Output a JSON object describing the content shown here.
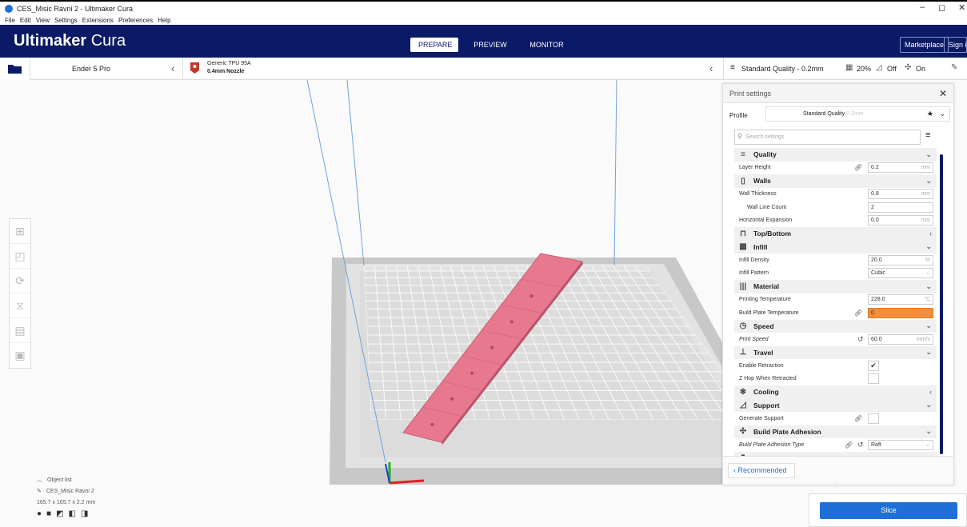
{
  "window": {
    "title": "CES_Misic Ravni 2 - Ultimaker Cura",
    "minimize": "–",
    "maximize": "◻",
    "close": "✕"
  },
  "menu": [
    "File",
    "Edit",
    "View",
    "Settings",
    "Extensions",
    "Preferences",
    "Help"
  ],
  "header": {
    "logo_bold": "Ultimaker",
    "logo_light": "Cura",
    "stages": [
      "PREPARE",
      "PREVIEW",
      "MONITOR"
    ],
    "marketplace": "Marketplace",
    "signin": "Sign in"
  },
  "machine": {
    "name": "Ender 5 Pro",
    "back": "‹"
  },
  "material": {
    "name": "Generic TPU 95A",
    "nozzle": "0.4mm Nozzle",
    "back": "‹"
  },
  "quality": {
    "profile": "Standard Quality - 0.2mm",
    "infill": "20%",
    "support": "Off",
    "adhesion": "On"
  },
  "panel": {
    "title": "Print settings",
    "profile_label": "Profile",
    "profile_value": "Standard Quality",
    "profile_suffix": "0.2mm",
    "search_placeholder": "Search settings",
    "recommended": "‹ Recommended",
    "rows": [
      {
        "kind": "cat",
        "icon": "≡",
        "label": "Quality",
        "chev": "⌄"
      },
      {
        "kind": "set",
        "label": "Layer Height",
        "value": "0.2",
        "unit": "mm",
        "link": true
      },
      {
        "kind": "cat",
        "icon": "▯",
        "label": "Walls",
        "chev": "⌄"
      },
      {
        "kind": "set",
        "label": "Wall Thickness",
        "value": "0.8",
        "unit": "mm"
      },
      {
        "kind": "set",
        "label": "Wall Line Count",
        "value": "2",
        "unit": "",
        "indent": true
      },
      {
        "kind": "set",
        "label": "Horizontal Expansion",
        "value": "0.0",
        "unit": "mm"
      },
      {
        "kind": "cat",
        "icon": "⊓",
        "label": "Top/Bottom",
        "chev": "‹"
      },
      {
        "kind": "cat",
        "icon": "▦",
        "label": "Infill",
        "chev": "⌄"
      },
      {
        "kind": "set",
        "label": "Infill Density",
        "value": "20.0",
        "unit": "%"
      },
      {
        "kind": "set",
        "label": "Infill Pattern",
        "value": "Cubic",
        "unit": "⌄"
      },
      {
        "kind": "cat",
        "icon": "|||",
        "label": "Material",
        "chev": "⌄"
      },
      {
        "kind": "set",
        "label": "Printing Temperature",
        "value": "228.0",
        "unit": "°C"
      },
      {
        "kind": "set",
        "label": "Build Plate Temperature",
        "value": "0",
        "unit": "°C",
        "link": true,
        "orange": true
      },
      {
        "kind": "cat",
        "icon": "◷",
        "label": "Speed",
        "chev": "⌄"
      },
      {
        "kind": "set",
        "label": "Print Speed",
        "value": "60.0",
        "unit": "mm/s",
        "reset": true,
        "italic": true
      },
      {
        "kind": "cat",
        "icon": "⊥",
        "label": "Travel",
        "chev": "⌄"
      },
      {
        "kind": "chk",
        "label": "Enable Retraction",
        "checked": "✔"
      },
      {
        "kind": "chk",
        "label": "Z Hop When Retracted",
        "checked": ""
      },
      {
        "kind": "cat",
        "icon": "❄",
        "label": "Cooling",
        "chev": "‹"
      },
      {
        "kind": "cat",
        "icon": "◿",
        "label": "Support",
        "chev": "⌄"
      },
      {
        "kind": "chk",
        "label": "Generate Support",
        "checked": "",
        "link": true
      },
      {
        "kind": "cat",
        "icon": "✣",
        "label": "Build Plate Adhesion",
        "chev": "⌄"
      },
      {
        "kind": "set",
        "label": "Build Plate Adhesion Type",
        "value": "Raft",
        "unit": "⌄",
        "link": true,
        "reset": true,
        "italic": true
      },
      {
        "kind": "cat",
        "icon": "▮",
        "label": "Dual Extrusion",
        "chev": "‹"
      }
    ]
  },
  "slice": {
    "label": "Slice"
  },
  "object": {
    "list_label": "Object list",
    "name": "CES_Misic Ravni 2",
    "dims": "165.7 x 165.7 x 2.2 mm"
  },
  "colors": {
    "brand": "#0b1a66",
    "accent": "#1e6fd8",
    "model": "#e8788e",
    "warning": "#f68d3a"
  }
}
